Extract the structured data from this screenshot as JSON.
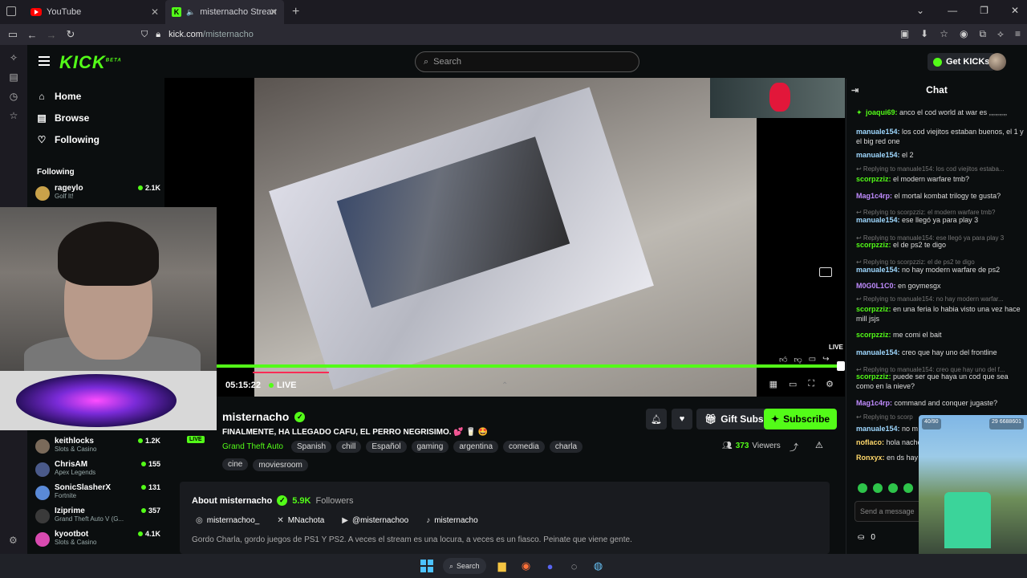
{
  "browser": {
    "tabs": [
      {
        "label": "YouTube",
        "icon": "youtube-icon"
      },
      {
        "label": "misternacho Stream - Wat",
        "icon": "kick-favicon-icon"
      }
    ],
    "url_domain": "kick.com",
    "url_path": "/misternacho"
  },
  "kick": {
    "logo": "KICK",
    "logo_sup": "BETA",
    "search_placeholder": "Search",
    "get_kicks": "Get KICKs"
  },
  "sidebar": {
    "nav": [
      {
        "label": "Home",
        "icon": "home-icon"
      },
      {
        "label": "Browse",
        "icon": "browse-icon"
      },
      {
        "label": "Following",
        "icon": "heart-icon"
      }
    ],
    "following_title": "Following",
    "channels": [
      {
        "name": "rageylo",
        "game": "Golf It!",
        "viewers": "2.1K",
        "color": "#c9a24a"
      },
      {
        "name": "keithlocks",
        "game": "Slots & Casino",
        "viewers": "1.2K",
        "color": "#7a6a5a"
      },
      {
        "name": "ChrisAM",
        "game": "Apex Legends",
        "viewers": "155",
        "color": "#4a5a8a"
      },
      {
        "name": "SonicSlasherX",
        "game": "Fortnite",
        "viewers": "131",
        "color": "#5a8ad8"
      },
      {
        "name": "Iziprime",
        "game": "Grand Theft Auto V (G...",
        "viewers": "357",
        "color": "#3a3a3a"
      },
      {
        "name": "kyootbot",
        "game": "Slots & Casino",
        "viewers": "4.1K",
        "color": "#d84ab0"
      }
    ]
  },
  "player": {
    "time": "05:15:22",
    "live_label": "LIVE",
    "live_mini": "LIVE"
  },
  "stream": {
    "live_badge": "LIVE",
    "streamer": "misternacho",
    "title": "FINALMENTE, HA LLEGADO CAFU, EL PERRO NEGRISIMO. 💕 🥛 🤩",
    "category": "Grand Theft Auto",
    "tags": [
      "Spanish",
      "chill",
      "Español",
      "gaming",
      "argentina",
      "comedia",
      "charla",
      "cine",
      "moviesroom"
    ],
    "gift_subs": "Gift Subs",
    "subscribe": "Subscribe",
    "viewers_count": "373",
    "viewers_label": "Viewers"
  },
  "about": {
    "title": "About misternacho",
    "followers_count": "5.9K",
    "followers_label": "Followers",
    "socials": [
      {
        "icon": "instagram-icon",
        "label": "misternachoo_"
      },
      {
        "icon": "x-icon",
        "label": "MNachota"
      },
      {
        "icon": "youtube-icon",
        "label": "@misternachoo"
      },
      {
        "icon": "tiktok-icon",
        "label": "misternacho"
      }
    ],
    "bio": "Gordo Charla, gordo juegos de PS1 Y PS2. A veces el stream es una locura, a veces es un fiasco. Peinate que viene gente."
  },
  "chat": {
    "title": "Chat",
    "input_placeholder": "Send a message",
    "kicks": "0",
    "messages": [
      {
        "type": "msg",
        "user": "joaqui69",
        "color": "#53fc18",
        "text": "anco el cod world at war es ,,,,,,,,,"
      },
      {
        "type": "msg",
        "user": "manuale154",
        "color": "#9fd8ff",
        "text": "los cod viejitos estaban buenos, el 1 y el big red one"
      },
      {
        "type": "msg",
        "user": "manuale154",
        "color": "#9fd8ff",
        "text": "el 2"
      },
      {
        "type": "reply",
        "text": "Replying to manuale154: los cod viejitos estaba..."
      },
      {
        "type": "msg",
        "user": "scorpzziz",
        "color": "#53fc18",
        "text": "el modern warfare tmb?"
      },
      {
        "type": "msg",
        "user": "Mag1c4rp",
        "color": "#c08cff",
        "text": "el mortal kombat trilogy te gusta?"
      },
      {
        "type": "reply",
        "text": "Replying to scorpzziz: el modern warfare tmb?"
      },
      {
        "type": "msg",
        "user": "manuale154",
        "color": "#9fd8ff",
        "text": "ese llegó ya para play 3"
      },
      {
        "type": "reply",
        "text": "Replying to manuale154: ese llegó ya para play 3"
      },
      {
        "type": "msg",
        "user": "scorpzziz",
        "color": "#53fc18",
        "text": "el de ps2 te digo"
      },
      {
        "type": "reply",
        "text": "Replying to scorpzziz: el de ps2 te digo"
      },
      {
        "type": "msg",
        "user": "manuale154",
        "color": "#9fd8ff",
        "text": "no hay modern warfare de ps2"
      },
      {
        "type": "msg",
        "user": "M0G0L1C0",
        "color": "#c08cff",
        "text": "en goymesgx"
      },
      {
        "type": "reply",
        "text": "Replying to manuale154: no hay modern warfar..."
      },
      {
        "type": "msg",
        "user": "scorpzziz",
        "color": "#53fc18",
        "text": "en una feria lo habia visto una vez hace mill jsjs"
      },
      {
        "type": "msg",
        "user": "scorpzziz",
        "color": "#53fc18",
        "text": "me comi el bait"
      },
      {
        "type": "msg",
        "user": "manuale154",
        "color": "#9fd8ff",
        "text": "creo que hay uno del frontline"
      },
      {
        "type": "reply",
        "text": "Replying to manuale154: creo que hay uno del f..."
      },
      {
        "type": "msg",
        "user": "scorpzziz",
        "color": "#53fc18",
        "text": "puede ser que haya un cod que sea como en la nieve?"
      },
      {
        "type": "msg",
        "user": "Mag1c4rp",
        "color": "#c08cff",
        "text": "command and conquer jugaste?"
      },
      {
        "type": "reply",
        "text": "Replying to scorp"
      },
      {
        "type": "msg",
        "user": "manuale154",
        "color": "#9fd8ff",
        "text": "no m"
      },
      {
        "type": "msg",
        "user": "noflaco",
        "color": "#ffd86b",
        "text": "hola nache"
      },
      {
        "type": "msg",
        "user": "Ronxyx",
        "color": "#ffd86b",
        "text": "en ds hay otra vez"
      }
    ]
  },
  "game_hud": {
    "left": "40/90",
    "right": "29 6688601"
  },
  "taskbar": {
    "search": "Search"
  }
}
